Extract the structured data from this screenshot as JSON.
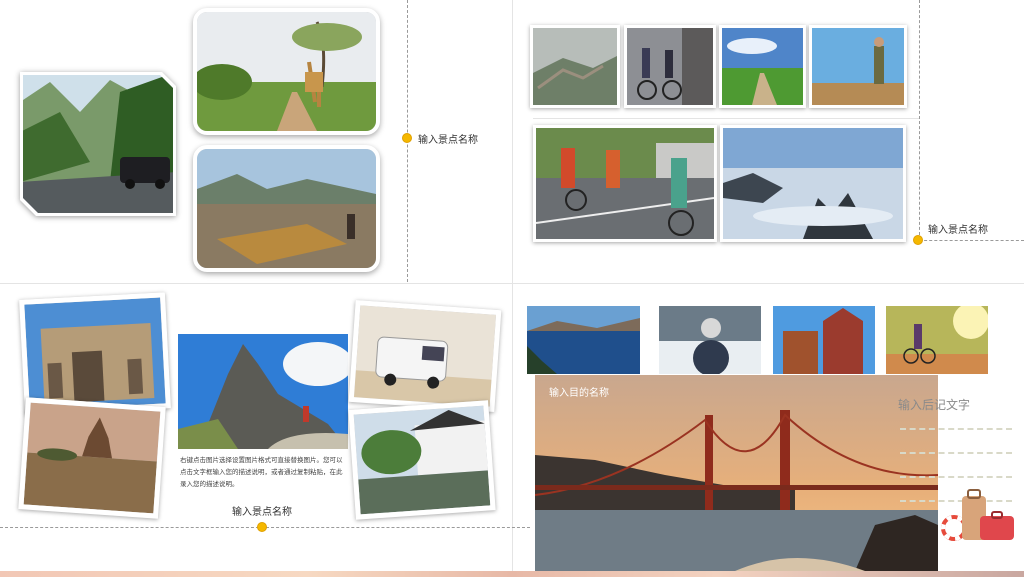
{
  "panels": {
    "top_left": {
      "caption": "输入景点名称"
    },
    "top_right": {
      "caption": "输入景点名称"
    },
    "bottom_left": {
      "caption": "输入景点名称",
      "description": "右键点击图片选择设置图片格式可直接替换图片。您可以点击文字框输入您的描述说明，或者通过复制粘贴，在此录入您的描述说明。"
    },
    "bottom_right": {
      "destination": "输入目的名称",
      "afterword": "输入后记文字"
    }
  },
  "photos": {
    "mountain_road": "mountain-road-photo",
    "giraffe": "giraffe-photo",
    "river_dock": "river-dock-photo",
    "great_wall": "great-wall-photo",
    "city_cyclists": "city-cyclists-photo",
    "country_path": "country-path-photo",
    "hiker": "hiker-photo",
    "road_cyclists": "road-cyclists-photo",
    "sea_of_clouds": "sea-of-clouds-photo",
    "triumphal_arch": "triumphal-arch-photo",
    "desert_temple": "desert-temple-photo",
    "rock_peak": "rock-peak-photo",
    "van": "van-photo",
    "water_town": "water-town-photo",
    "crater_lake": "crater-lake-photo",
    "winter_traveler": "winter-traveler-photo",
    "red_buildings": "red-buildings-photo",
    "sunset_cyclist": "sunset-cyclist-photo",
    "golden_gate": "golden-gate-photo"
  },
  "colors": {
    "accent_dot": "#f5b800",
    "divider": "#e4e4e4",
    "dash": "#9a9a9a"
  }
}
